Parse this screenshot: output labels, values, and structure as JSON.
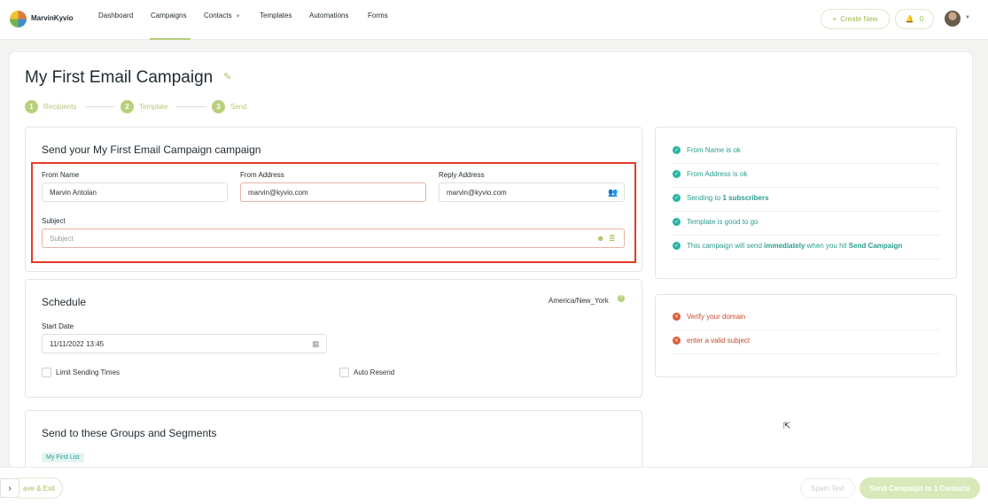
{
  "nav": {
    "brand": "MarvinKyvio",
    "items": [
      "Dashboard",
      "Campaigns",
      "Contacts",
      "Templates",
      "Automations",
      "Forms"
    ],
    "active": "Campaigns",
    "create_label": "Create New",
    "notifications": "0"
  },
  "page": {
    "title": "My First Email Campaign",
    "steps": [
      {
        "num": "1",
        "label": "Recipients"
      },
      {
        "num": "2",
        "label": "Template"
      },
      {
        "num": "3",
        "label": "Send"
      }
    ]
  },
  "send_panel": {
    "title": "Send your My First Email Campaign campaign",
    "from_name_label": "From Name",
    "from_name_value": "Marvin Antolan",
    "from_address_label": "From Address",
    "from_address_value": "marvin@kyvio.com",
    "reply_label": "Reply Address",
    "reply_value": "marvin@kyvio.com",
    "subject_label": "Subject",
    "subject_placeholder": "Subject"
  },
  "schedule": {
    "title": "Schedule",
    "timezone": "America/New_York",
    "start_label": "Start Date",
    "start_value": "11/11/2022 13:45",
    "limit_label": "Limit Sending Times",
    "resend_label": "Auto Resend"
  },
  "groups": {
    "title": "Send to these Groups and Segments",
    "tags": [
      "My First List"
    ]
  },
  "checks_ok": [
    {
      "pre": "From Name is ok",
      "bold": "",
      "mid": "",
      "bold2": ""
    },
    {
      "pre": "From Address is ok",
      "bold": "",
      "mid": "",
      "bold2": ""
    },
    {
      "pre": "Sending to ",
      "bold": "1 subscribers",
      "mid": "",
      "bold2": ""
    },
    {
      "pre": "Template is good to go",
      "bold": "",
      "mid": "",
      "bold2": ""
    },
    {
      "pre": "This campaign will send ",
      "bold": "immediately",
      "mid": " when you hit ",
      "bold2": "Send Campaign"
    }
  ],
  "checks_err": [
    "Verify your domain",
    "enter a valid subject"
  ],
  "footer": {
    "save_exit": "ave & Exit",
    "spam_test": "Spam Test",
    "send": "Send Campaign to 1 Contacts"
  },
  "colors": {
    "accent": "#b5cc7a",
    "ok": "#2a9d8f",
    "error": "#c94a2c",
    "highlight": "#e33a2b"
  }
}
